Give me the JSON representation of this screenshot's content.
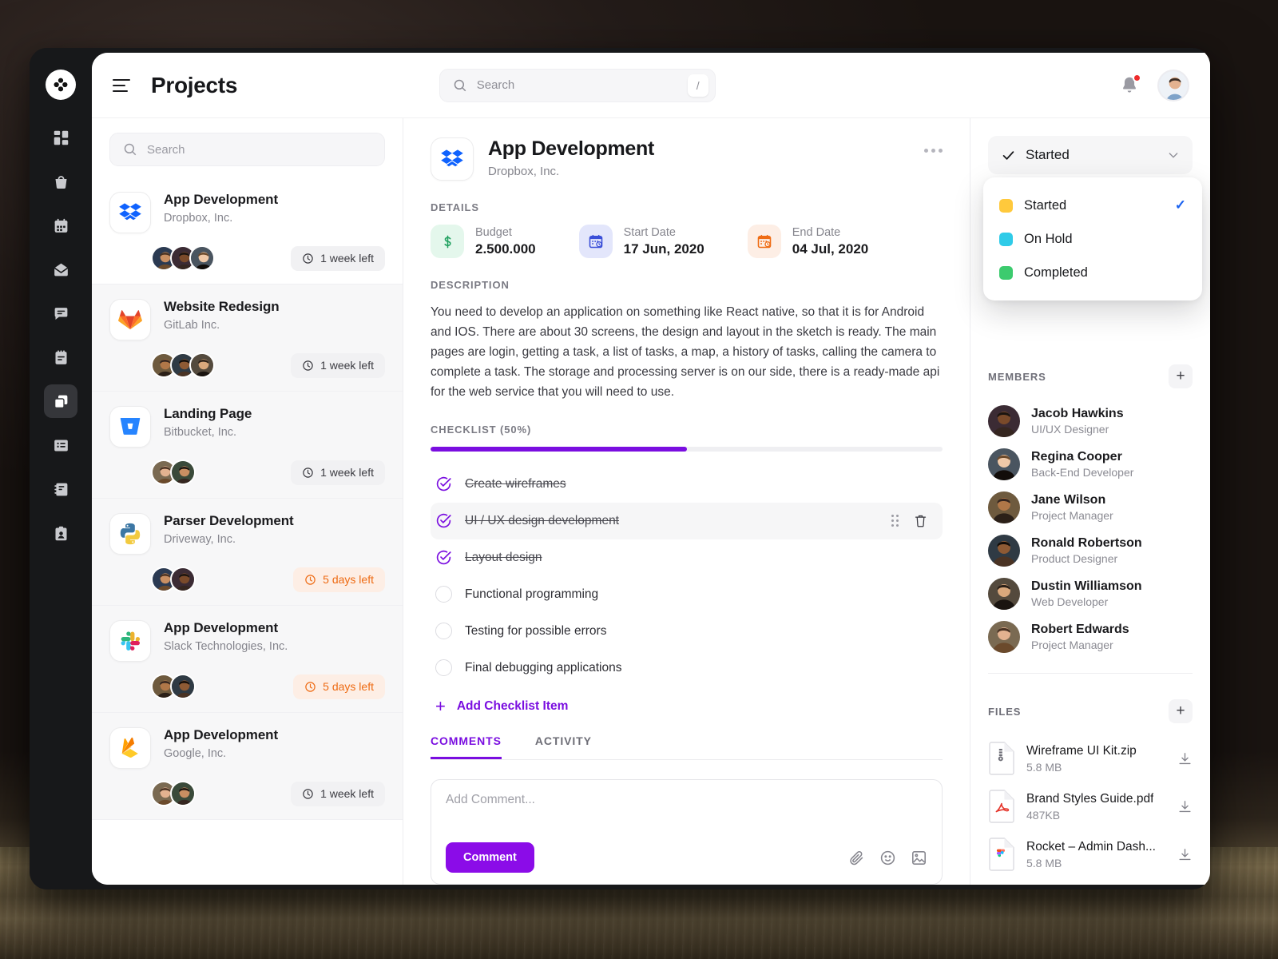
{
  "header": {
    "title": "Projects",
    "menu_icon": "hamburger-icon",
    "search": {
      "placeholder": "Search",
      "value": "",
      "shortcut": "/"
    },
    "notification_icon": "bell-icon",
    "avatar": "user-avatar"
  },
  "rail": {
    "logo": "app-logo",
    "items": [
      {
        "icon": "dashboard-icon",
        "active": false
      },
      {
        "icon": "bag-icon",
        "active": false
      },
      {
        "icon": "calendar-icon",
        "active": false
      },
      {
        "icon": "mail-icon",
        "active": false
      },
      {
        "icon": "chat-icon",
        "active": false
      },
      {
        "icon": "notes-icon",
        "active": false
      },
      {
        "icon": "projects-icon",
        "active": true
      },
      {
        "icon": "list-icon",
        "active": false
      },
      {
        "icon": "contacts-book-icon",
        "active": false
      },
      {
        "icon": "id-card-icon",
        "active": false
      }
    ]
  },
  "project_list": {
    "search": {
      "placeholder": "Search",
      "value": ""
    },
    "items": [
      {
        "name": "App Development",
        "company": "Dropbox, Inc.",
        "logo": "dropbox",
        "avatars": 3,
        "due": "1 week left",
        "urgent": false,
        "selected": true
      },
      {
        "name": "Website Redesign",
        "company": "GitLab Inc.",
        "logo": "gitlab",
        "avatars": 3,
        "due": "1 week left",
        "urgent": false,
        "selected": false
      },
      {
        "name": "Landing Page",
        "company": "Bitbucket, Inc.",
        "logo": "bitbucket",
        "avatars": 2,
        "due": "1 week left",
        "urgent": false,
        "selected": false
      },
      {
        "name": "Parser Development",
        "company": "Driveway, Inc.",
        "logo": "python",
        "avatars": 2,
        "due": "5 days left",
        "urgent": true,
        "selected": false
      },
      {
        "name": "App Development",
        "company": "Slack Technologies, Inc.",
        "logo": "slack",
        "avatars": 2,
        "due": "5 days left",
        "urgent": true,
        "selected": false
      },
      {
        "name": "App Development",
        "company": "Google, Inc.",
        "logo": "firebase",
        "avatars": 2,
        "due": "1 week left",
        "urgent": false,
        "selected": false
      }
    ]
  },
  "detail": {
    "title": "App Development",
    "company": "Dropbox, Inc.",
    "logo": "dropbox",
    "more_icon": "more-options-icon",
    "details_label": "DETAILS",
    "details": [
      {
        "key": "Budget",
        "value": "2.500.000",
        "icon": "dollar-icon"
      },
      {
        "key": "Start Date",
        "value": "17 Jun, 2020",
        "icon": "calendar-start-icon"
      },
      {
        "key": "End Date",
        "value": "04 Jul, 2020",
        "icon": "calendar-end-icon"
      }
    ],
    "description_label": "DESCRIPTION",
    "description": "You need to develop an application on something like React native, so that it is for Android and IOS. There are about 30 screens, the design and layout in the sketch is ready. The main pages are login, getting a task, a list of tasks, a map, a history of tasks, calling the camera to complete a task. The storage and processing server is on our side, there is a ready-made api for the web service that you will need to use.",
    "checklist_label": "CHECKLIST (50%)",
    "checklist_percent": 50,
    "checklist": [
      {
        "text": "Create wireframes",
        "done": true,
        "hover": false
      },
      {
        "text": "UI / UX design development",
        "done": true,
        "hover": true
      },
      {
        "text": "Layout design",
        "done": true,
        "hover": false
      },
      {
        "text": "Functional programming",
        "done": false,
        "hover": false
      },
      {
        "text": "Testing for possible errors",
        "done": false,
        "hover": false
      },
      {
        "text": "Final debugging applications",
        "done": false,
        "hover": false
      }
    ],
    "add_checklist_label": "Add Checklist Item",
    "tabs": [
      {
        "label": "COMMENTS",
        "active": true
      },
      {
        "label": "ACTIVITY",
        "active": false
      }
    ],
    "comment_box": {
      "placeholder": "Add Comment...",
      "value": "",
      "submit_label": "Comment",
      "icons": [
        "attachment-icon",
        "emoji-icon",
        "image-icon"
      ]
    }
  },
  "right": {
    "status": {
      "selected": "Started",
      "chevron": "chevron-down-icon",
      "options": [
        {
          "label": "Started",
          "color": "#ffc93c",
          "selected": true
        },
        {
          "label": "On Hold",
          "color": "#2fcbe8",
          "selected": false
        },
        {
          "label": "Completed",
          "color": "#3ccb6e",
          "selected": false
        }
      ]
    },
    "members_label": "MEMBERS",
    "members_add": "+",
    "members": [
      {
        "name": "Jacob Hawkins",
        "role": "UI/UX Designer"
      },
      {
        "name": "Regina Cooper",
        "role": "Back-End Developer"
      },
      {
        "name": "Jane Wilson",
        "role": "Project Manager"
      },
      {
        "name": "Ronald Robertson",
        "role": "Product Designer"
      },
      {
        "name": "Dustin Williamson",
        "role": "Web Developer"
      },
      {
        "name": "Robert Edwards",
        "role": "Project Manager"
      }
    ],
    "files_label": "FILES",
    "files_add": "+",
    "files": [
      {
        "name": "Wireframe UI Kit.zip",
        "size": "5.8 MB",
        "type": "zip"
      },
      {
        "name": "Brand Styles Guide.pdf",
        "size": "487KB",
        "type": "pdf"
      },
      {
        "name": "Rocket – Admin Dash...",
        "size": "5.8 MB",
        "type": "figma"
      }
    ]
  },
  "colors": {
    "accent": "#7a0ee0",
    "accent_button": "#8b0ce8",
    "warning": "#ee6a12",
    "tick_blue": "#1a62f0",
    "rail_bg": "#17181a"
  }
}
